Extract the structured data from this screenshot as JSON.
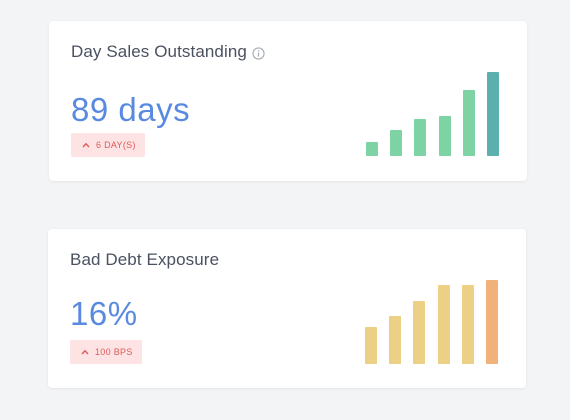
{
  "cards": [
    {
      "id": "card-dso",
      "title": "Day Sales Outstanding",
      "has_info_icon": true,
      "value": "89 days",
      "change": "6 DAY(S)",
      "change_direction": "up",
      "bars": [
        0.17,
        0.31,
        0.44,
        0.48,
        0.79,
        1.0
      ],
      "bar_color": "#7dd3a3",
      "highlight_color": "#5bb0ad"
    },
    {
      "id": "card-bde",
      "title": "Bad Debt Exposure",
      "has_info_icon": false,
      "value": "16%",
      "change": "100 BPS",
      "change_direction": "up",
      "bars": [
        0.44,
        0.57,
        0.75,
        0.94,
        0.94,
        1.0
      ],
      "bar_color": "#ecd085",
      "highlight_color": "#f0b27a"
    }
  ],
  "colors": {
    "value": "#5a8ae0",
    "badge_bg": "#fde3e3",
    "badge_text": "#e05a5a",
    "title": "#4a5160",
    "background": "#f3f4f6"
  }
}
